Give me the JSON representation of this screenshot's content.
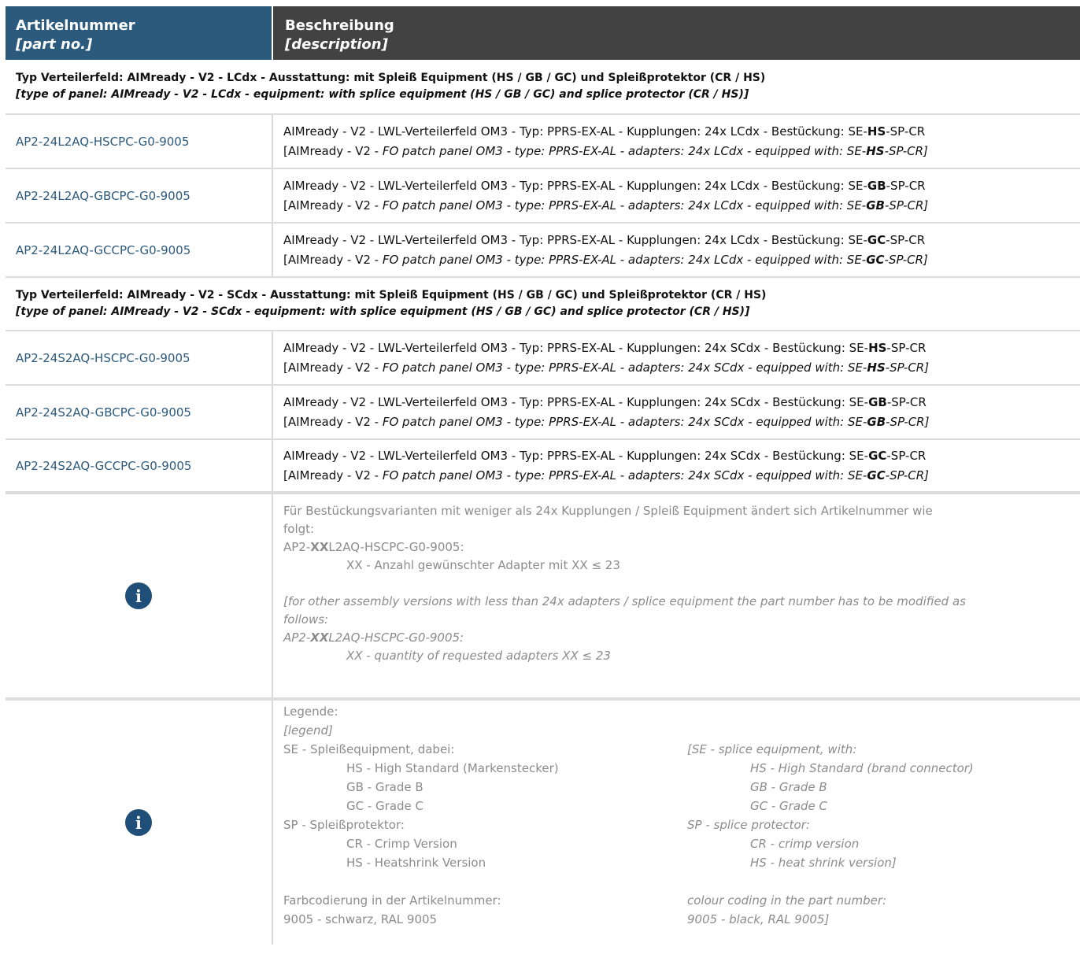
{
  "header": {
    "col1_de": "Artikelnummer",
    "col1_en": "[part no.]",
    "col2_de": "Beschreibung",
    "col2_en": "[description]"
  },
  "sections": [
    {
      "title_de": "Typ Verteilerfeld: AIMready - V2 -  LCdx - Ausstattung: mit Spleiß Equipment (HS / GB / GC) und Spleißprotektor (CR / HS)",
      "title_en": "[type of panel: AIMready - V2 -  LCdx - equipment: with splice equipment (HS / GB / GC) and splice protector (CR / HS)]",
      "rows": [
        {
          "part": "AP2-24L2AQ-HSCPC-G0-9005",
          "de_pre": "AIMready - V2 - LWL-Verteilerfeld OM3 - Typ: PPRS-EX-AL - Kupplungen: 24x LCdx - Bestückung: SE-",
          "de_bold": "HS",
          "de_post": "-SP-CR",
          "en_pre1": "[AIMready - V2 - ",
          "en_pre2": "FO patch panel OM3 - type: PPRS-EX-AL - adapters: 24x LCdx - equipped with: SE-",
          "en_bold": "HS",
          "en_post": "-SP-CR]"
        },
        {
          "part": "AP2-24L2AQ-GBCPC-G0-9005",
          "de_pre": "AIMready - V2 - LWL-Verteilerfeld OM3 - Typ: PPRS-EX-AL - Kupplungen: 24x LCdx - Bestückung: SE-",
          "de_bold": "GB",
          "de_post": "-SP-CR",
          "en_pre1": "[AIMready - V2 - ",
          "en_pre2": "FO patch panel OM3 - type: PPRS-EX-AL - adapters: 24x LCdx - equipped with: SE-",
          "en_bold": "GB",
          "en_post": "-SP-CR]"
        },
        {
          "part": "AP2-24L2AQ-GCCPC-G0-9005",
          "de_pre": "AIMready - V2 - LWL-Verteilerfeld OM3 - Typ: PPRS-EX-AL - Kupplungen: 24x LCdx - Bestückung: SE-",
          "de_bold": "GC",
          "de_post": "-SP-CR",
          "en_pre1": "[AIMready - V2 - ",
          "en_pre2": "FO patch panel OM3 - type: PPRS-EX-AL - adapters: 24x LCdx - equipped with: SE-",
          "en_bold": "GC",
          "en_post": "-SP-CR]"
        }
      ]
    },
    {
      "title_de": "Typ Verteilerfeld: AIMready - V2 -  SCdx - Ausstattung: mit Spleiß Equipment (HS / GB / GC) und Spleißprotektor (CR / HS)",
      "title_en": "[type of panel: AIMready - V2 -  SCdx - equipment: with splice equipment (HS / GB / GC) and splice protector (CR / HS)]",
      "rows": [
        {
          "part": "AP2-24S2AQ-HSCPC-G0-9005",
          "de_pre": "AIMready - V2 - LWL-Verteilerfeld OM3 - Typ: PPRS-EX-AL - Kupplungen: 24x SCdx - Bestückung: SE-",
          "de_bold": "HS",
          "de_post": "-SP-CR",
          "en_pre1": "[AIMready - V2 - ",
          "en_pre2": "FO patch panel OM3 - type: PPRS-EX-AL - adapters: 24x SCdx - equipped with: SE-",
          "en_bold": "HS",
          "en_post": "-SP-CR]"
        },
        {
          "part": "AP2-24S2AQ-GBCPC-G0-9005",
          "de_pre": "AIMready - V2 - LWL-Verteilerfeld OM3 - Typ: PPRS-EX-AL - Kupplungen: 24x SCdx - Bestückung: SE-",
          "de_bold": "GB",
          "de_post": "-SP-CR",
          "en_pre1": "[AIMready - V2 - ",
          "en_pre2": "FO patch panel OM3 - type: PPRS-EX-AL - adapters: 24x SCdx - equipped with: SE-",
          "en_bold": "GB",
          "en_post": "-SP-CR]"
        },
        {
          "part": "AP2-24S2AQ-GCCPC-G0-9005",
          "de_pre": "AIMready - V2 - LWL-Verteilerfeld OM3 - Typ: PPRS-EX-AL - Kupplungen: 24x SCdx - Bestückung: SE-",
          "de_bold": "GC",
          "de_post": "-SP-CR",
          "en_pre1": "[AIMready - V2 - ",
          "en_pre2": "FO patch panel OM3 - type: PPRS-EX-AL - adapters: 24x SCdx - equipped with: SE-",
          "en_bold": "GC",
          "en_post": "-SP-CR]"
        }
      ]
    }
  ],
  "note1": {
    "icon": "info-icon",
    "de_line1": "Für Bestückungsvarianten mit weniger als 24x Kupplungen / Spleiß Equipment ändert sich Artikelnummer wie",
    "de_line2": "folgt:",
    "de_code_pre": "AP2-",
    "de_code_bold": "XX",
    "de_code_post": "L2AQ-HSCPC-G0-9005:",
    "de_xx": "XX - Anzahl gewünschter Adapter mit XX ≤ 23",
    "en_line1": "[for other assembly versions with less than 24x adapters / splice equipment the part number has to be modified as",
    "en_line2": "follows:",
    "en_code_pre": "AP2-",
    "en_code_bold": "XX",
    "en_code_post": "L2AQ-HSCPC-G0-9005:",
    "en_xx": "XX - quantity of requested adapters XX ≤ 23"
  },
  "note2": {
    "icon": "info-icon",
    "legend_title": "Legende:",
    "legend_en": "[legend]",
    "left": {
      "se": "SE - Spleißequipment, dabei:",
      "hs": "HS - High Standard (Markenstecker)",
      "gb": "GB - Grade B",
      "gc": "GC - Grade C",
      "sp": "SP - Spleißprotektor:",
      "cr": "CR - Crimp Version",
      "hs2": "HS - Heatshrink Version",
      "color": "Farbcodierung in der Artikelnummer:",
      "code": "9005 - schwarz, RAL 9005"
    },
    "right": {
      "se": "[SE - splice equipment, with:",
      "hs": "HS - High Standard (brand connector)",
      "gb": "GB - Grade B",
      "gc": "GC - Grade C",
      "sp": "SP - splice protector:",
      "cr": "CR - crimp version",
      "hs2": "HS - heat shrink version]",
      "color": "colour coding in the part number:",
      "code": "9005 - black, RAL 9005]"
    }
  }
}
